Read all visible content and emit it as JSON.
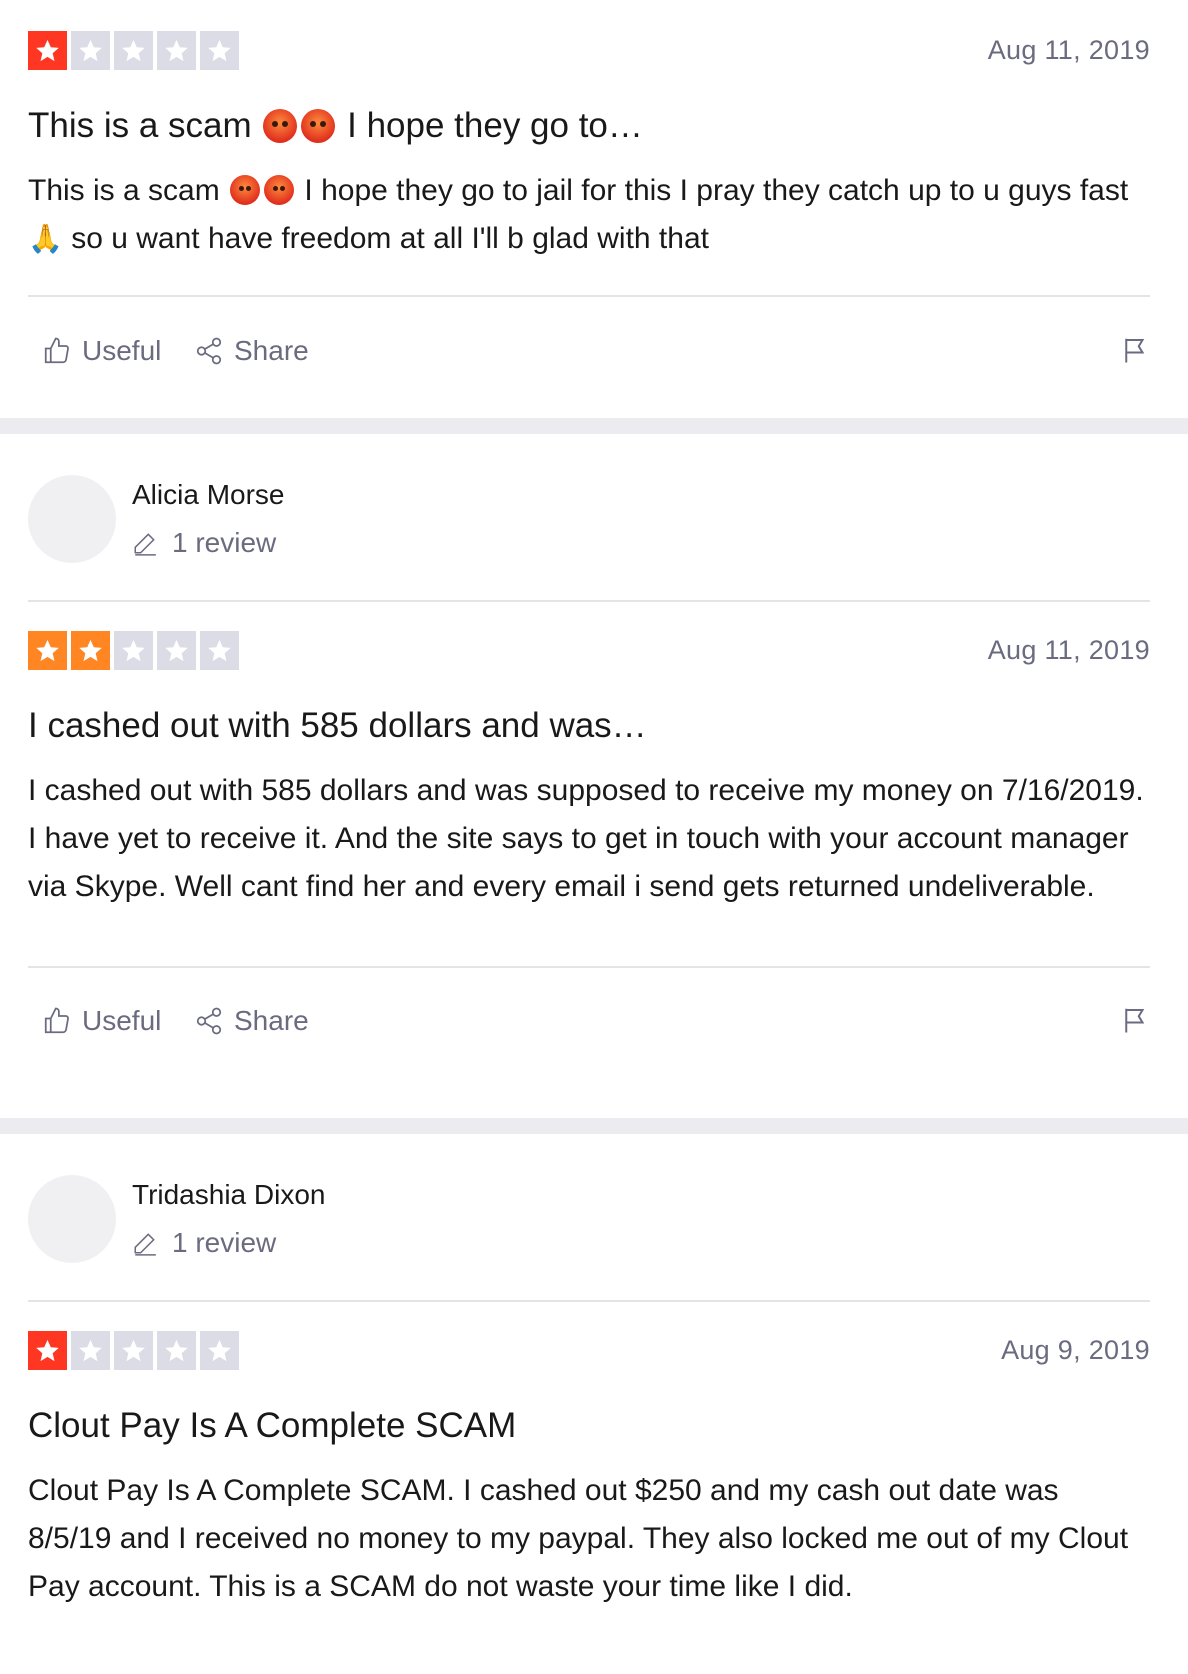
{
  "colors": {
    "star_red": "#ff3722",
    "star_orange": "#ff8622",
    "star_empty": "#dcdce6",
    "muted": "#6b6b80",
    "gap": "#ececf0"
  },
  "actions": {
    "useful": "Useful",
    "share": "Share"
  },
  "reviews": [
    {
      "rating": 1,
      "date": "Aug 11, 2019",
      "title_parts": [
        "This is a scam",
        "I hope they go to…"
      ],
      "body_parts": [
        "This is a scam",
        "I hope they go to jail for this I pray they catch up to u guys fast",
        "so u want have freedom at all I'll b glad with that"
      ]
    },
    {
      "consumer": {
        "name": "Alicia Morse",
        "review_count": "1 review"
      },
      "rating": 2,
      "date": "Aug 11, 2019",
      "title": "I cashed out with 585 dollars and was…",
      "body": "I cashed out with 585 dollars and was supposed to receive my money on 7/16/2019. I have yet to receive it. And the site says to get in touch with your account manager via Skype. Well cant find her and every email i send gets returned undeliverable."
    },
    {
      "consumer": {
        "name": "Tridashia Dixon",
        "review_count": "1 review"
      },
      "rating": 1,
      "date": "Aug 9, 2019",
      "title": "Clout Pay Is A Complete SCAM",
      "body": "Clout Pay Is A Complete SCAM. I cashed out $250 and my cash out date was 8/5/19 and I received no money to my paypal. They also locked me out of my Clout Pay account. This is a SCAM do not waste your time like I did."
    }
  ]
}
